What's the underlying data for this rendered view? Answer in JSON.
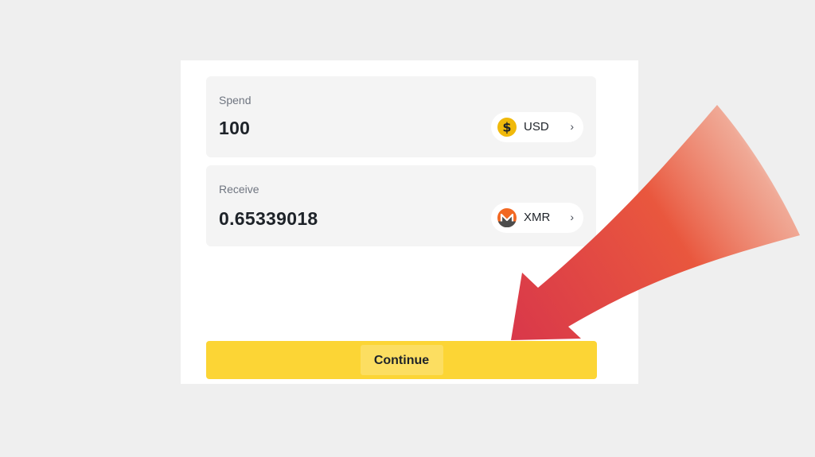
{
  "spend": {
    "label": "Spend",
    "amount": "100",
    "currency": "USD",
    "currency_icon": "dollar-coin-icon",
    "currency_icon_color": "#f0b90b"
  },
  "receive": {
    "label": "Receive",
    "amount": "0.65339018",
    "currency": "XMR",
    "currency_icon": "monero-icon",
    "currency_icon_color": "#f26822"
  },
  "continue_button": {
    "label": "Continue",
    "color": "#fcd535"
  },
  "annotation": {
    "icon": "red-arrow-icon",
    "color": "#e0443c"
  }
}
